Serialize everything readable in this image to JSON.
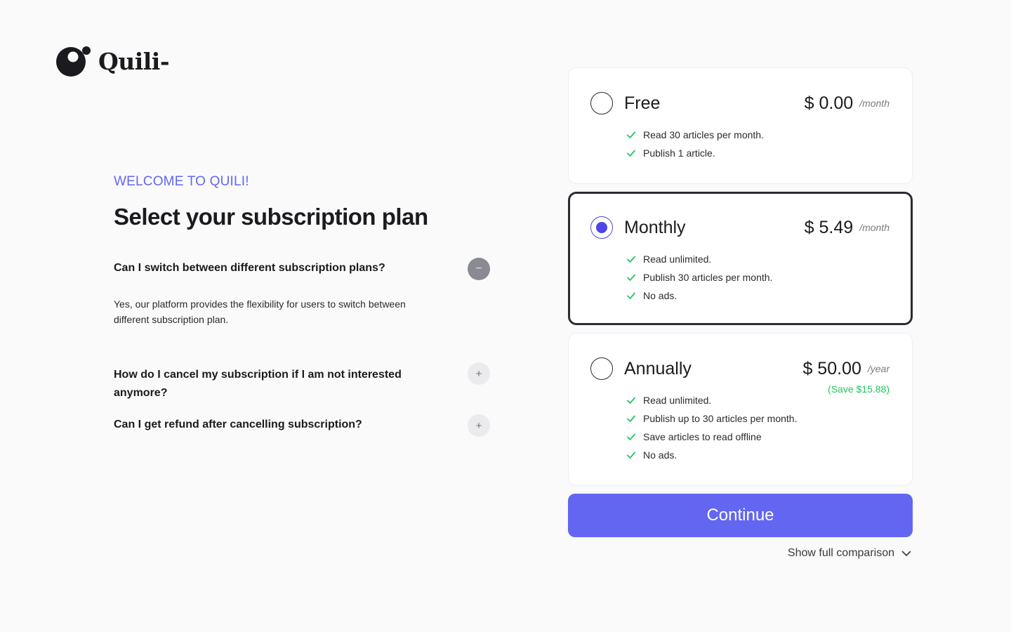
{
  "brand": {
    "name": "Quili-"
  },
  "intro": {
    "welcome": "WELCOME TO QUILI!",
    "title": "Select your subscription plan"
  },
  "faq": [
    {
      "question": "Can I switch between different subscription plans?",
      "answer": "Yes, our platform provides the flexibility for users to switch between different subscription plan.",
      "toggle": "−",
      "expanded": true
    },
    {
      "question": "How do I cancel my subscription if I am not interested anymore?",
      "toggle": "+",
      "expanded": false
    },
    {
      "question": "Can I get refund after cancelling subscription?",
      "toggle": "+",
      "expanded": false
    }
  ],
  "plans": [
    {
      "name": "Free",
      "price": "$ 0.00",
      "period": "/month",
      "selected": false,
      "features": [
        "Read 30 articles per month.",
        "Publish 1 article."
      ]
    },
    {
      "name": "Monthly",
      "price": "$ 5.49",
      "period": "/month",
      "selected": true,
      "features": [
        "Read unlimited.",
        "Publish 30 articles per month.",
        "No ads."
      ]
    },
    {
      "name": "Annually",
      "price": "$ 50.00",
      "period": "/year",
      "savings": "(Save $15.88)",
      "selected": false,
      "features": [
        "Read unlimited.",
        "Publish up to 30 articles per month.",
        "Save articles to read offline",
        "No ads."
      ]
    }
  ],
  "actions": {
    "continue": "Continue",
    "show_comparison": "Show full comparison"
  },
  "colors": {
    "accent": "#6366f1",
    "radio_selected": "#4f46e5",
    "check": "#22c55e",
    "savings": "#22c55e",
    "background": "#fafafa"
  }
}
